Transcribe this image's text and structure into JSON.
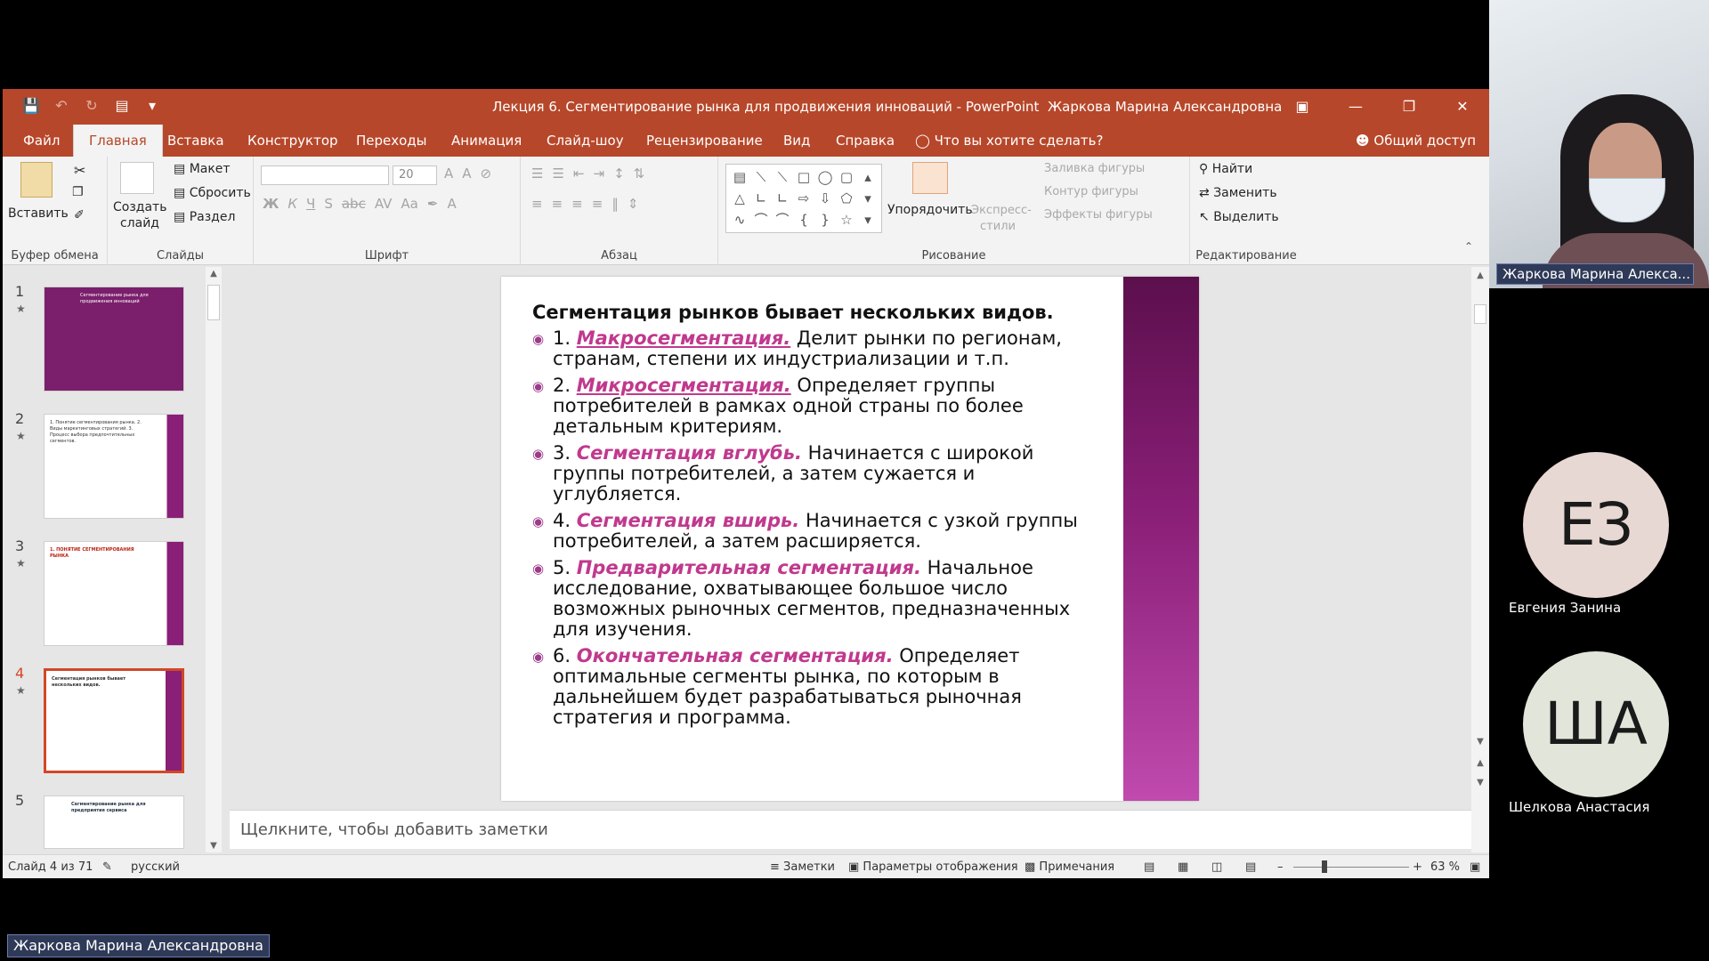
{
  "titlebar": {
    "doc_title": "Лекция 6. Сегментирование рынка для продвижения инноваций  -  PowerPoint",
    "user": "Жаркова Марина Александровна",
    "qat": [
      "save-icon",
      "undo-icon",
      "redo-icon",
      "present-icon",
      "customize-icon"
    ],
    "window": [
      "ribbon-display-icon",
      "minimize-icon",
      "restore-icon",
      "close-icon"
    ]
  },
  "tabs": [
    "Файл",
    "Главная",
    "Вставка",
    "Конструктор",
    "Переходы",
    "Анимация",
    "Слайд-шоу",
    "Рецензирование",
    "Вид",
    "Справка"
  ],
  "active_tab": "Главная",
  "tellme": "Что вы хотите сделать?",
  "share": "Общий доступ",
  "ribbon": {
    "clipboard": {
      "paste": "Вставить",
      "label": "Буфер обмена"
    },
    "slides": {
      "new_slide": "Создать слайд",
      "layout": "Макет",
      "reset": "Сбросить",
      "section": "Раздел",
      "label": "Слайды"
    },
    "font": {
      "size": "20",
      "label": "Шрифт",
      "bold": "Ж",
      "italic": "К",
      "underline": "Ч",
      "shadow": "S",
      "strike": "abc",
      "spacing": "AV",
      "case": "Aa",
      "color": "A"
    },
    "paragraph": {
      "label": "Абзац"
    },
    "drawing": {
      "arrange": "Упорядочить",
      "quick_styles": "Экспресс-стили",
      "fill": "Заливка фигуры",
      "outline": "Контур фигуры",
      "effects": "Эффекты фигуры",
      "label": "Рисование"
    },
    "editing": {
      "find": "Найти",
      "replace": "Заменить",
      "select": "Выделить",
      "label": "Редактирование"
    }
  },
  "thumbnails": [
    {
      "num": "1",
      "text": "Сегментирование рынка для продвижения инноваций"
    },
    {
      "num": "2",
      "text": "1. Понятие сегментирования рынка. 2. Виды маркетинговых стратегий. 3. Процесс выбора предпочтительных сегментов."
    },
    {
      "num": "3",
      "text": "1. ПОНЯТИЕ СЕГМЕНТИРОВАНИЯ РЫНКА"
    },
    {
      "num": "4",
      "text": "Сегментация рынков бывает нескольких видов."
    },
    {
      "num": "5",
      "text": "Сегментирование рынка для предприятия сервиса"
    }
  ],
  "active_slide": "4",
  "slide": {
    "title": "Сегментация рынков бывает нескольких видов.",
    "items": [
      {
        "num": "1.",
        "term": "Макросегментация.",
        "text": "Делит рынки по регионам, странам, степени их индустриализации и т.п."
      },
      {
        "num": "2.",
        "term": "Микросегментация.",
        "text": "Определяет группы потребителей в рамках одной страны по более детальным критериям."
      },
      {
        "num": "3.",
        "term": "Сегментация вглубь.",
        "text": "Начинается с широкой группы потребителей, а затем сужается и углубляется."
      },
      {
        "num": "4.",
        "term": "Сегментация вширь.",
        "text": "Начинается с узкой группы потребителей, а затем расширяется."
      },
      {
        "num": "5.",
        "term": "Предварительная сегментация.",
        "text": "Начальное исследование, охватывающее большое число возможных рыночных сегментов, предназначенных для изучения."
      },
      {
        "num": "6.",
        "term": "Окончательная сегментация.",
        "text": "Определяет оптимальные сегменты рынка, по которым в дальнейшем будет разрабатываться рыночная стратегия и программа."
      }
    ]
  },
  "notes_placeholder": "Щелкните, чтобы добавить заметки",
  "status": {
    "slide_counter": "Слайд 4 из 71",
    "language": "русский",
    "notes": "Заметки",
    "display_settings": "Параметры отображения",
    "comments": "Примечания",
    "zoom": "63 %"
  },
  "participants": [
    {
      "name": "Жаркова Марина Алекса...",
      "kind": "video"
    },
    {
      "initials": "ЕЗ",
      "name": "Евгения Занина"
    },
    {
      "initials": "ША",
      "name": "Шелкова Анастасия"
    }
  ],
  "presenter_label": "Жаркова Марина Александровна",
  "colors": {
    "ppt_accent": "#b7472a",
    "term": "#c0398e",
    "slide_bar": "#8a1f77"
  }
}
